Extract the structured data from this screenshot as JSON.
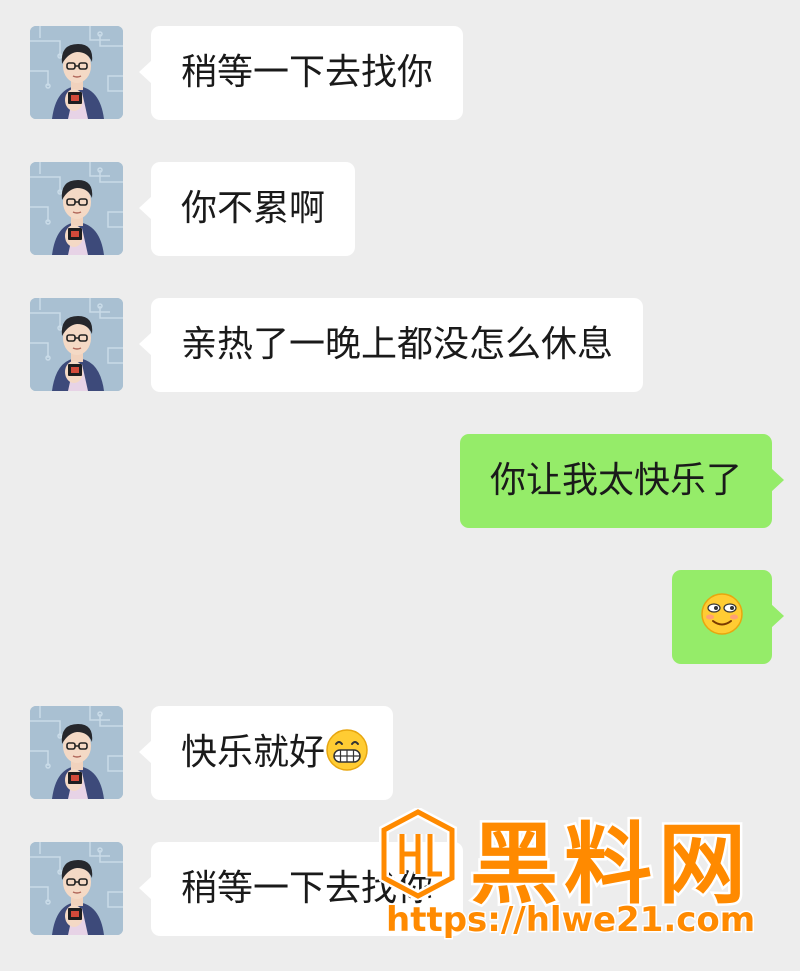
{
  "messages": [
    {
      "side": "in",
      "text": "稍等一下去找你"
    },
    {
      "side": "in",
      "text": "你不累啊"
    },
    {
      "side": "in",
      "text": "亲热了一晚上都没怎么休息"
    },
    {
      "side": "out",
      "text": "你让我太快乐了"
    },
    {
      "side": "out",
      "emoji": "smirk-emoji"
    },
    {
      "side": "in",
      "text": "快乐就好",
      "emoji": "grin-emoji"
    },
    {
      "side": "in",
      "text": "稍等一下去找你"
    }
  ],
  "colors": {
    "background": "#ededed",
    "incoming_bubble": "#ffffff",
    "outgoing_bubble": "#95ec69",
    "watermark": "#ff8a00"
  },
  "watermark": {
    "brand": "黑料网",
    "url": "https://hlwe21.com"
  }
}
